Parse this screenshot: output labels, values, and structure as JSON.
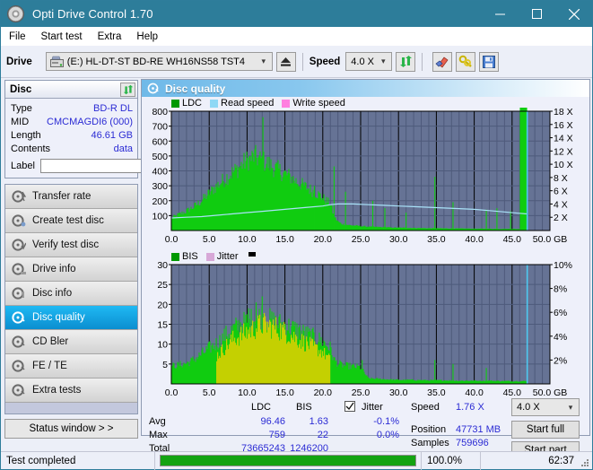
{
  "window": {
    "title": "Opti Drive Control 1.70",
    "icon": "disc-icon",
    "minimize": "minimize-icon",
    "maximize": "maximize-icon",
    "close": "close-icon"
  },
  "menu": {
    "items": [
      "File",
      "Start test",
      "Extra",
      "Help"
    ]
  },
  "toolbar": {
    "drive_label": "Drive",
    "drive_value": "(E:)  HL-DT-ST BD-RE  WH16NS58 TST4",
    "eject_icon": "eject-icon",
    "speed_label": "Speed",
    "speed_value": "4.0 X",
    "refresh_icon": "refresh-icon",
    "erase_icon": "eraser-icon",
    "key_icon": "keys-icon",
    "save_icon": "save-icon"
  },
  "disc_panel": {
    "title": "Disc",
    "refresh_icon": "refresh-icon",
    "rows": [
      {
        "key": "Type",
        "value": "BD-R DL"
      },
      {
        "key": "MID",
        "value": "CMCMAGDI6 (000)"
      },
      {
        "key": "Length",
        "value": "46.61 GB"
      },
      {
        "key": "Contents",
        "value": "data"
      }
    ],
    "label_key": "Label",
    "label_value": "",
    "label_placeholder": "",
    "label_button_icon": "disc-icon"
  },
  "nav": {
    "items": [
      {
        "label": "Transfer rate",
        "icon": "disc-transfer-icon",
        "selected": false
      },
      {
        "label": "Create test disc",
        "icon": "disc-create-icon",
        "selected": false
      },
      {
        "label": "Verify test disc",
        "icon": "disc-verify-icon",
        "selected": false
      },
      {
        "label": "Drive info",
        "icon": "disc-drive-icon",
        "selected": false
      },
      {
        "label": "Disc info",
        "icon": "disc-info-icon",
        "selected": false
      },
      {
        "label": "Disc quality",
        "icon": "disc-quality-icon",
        "selected": true
      },
      {
        "label": "CD Bler",
        "icon": "disc-bler-icon",
        "selected": false
      },
      {
        "label": "FE / TE",
        "icon": "disc-fete-icon",
        "selected": false
      },
      {
        "label": "Extra tests",
        "icon": "disc-extra-icon",
        "selected": false
      }
    ],
    "status_window_label": "Status window > >"
  },
  "card": {
    "title": "Disc quality",
    "icon": "disc-quality-icon"
  },
  "stats": {
    "col_ldc": "LDC",
    "col_bis": "BIS",
    "jitter_label": "Jitter",
    "jitter_checked": true,
    "rows": [
      {
        "key": "Avg",
        "ldc": "96.46",
        "bis": "1.63",
        "jitter": "-0.1%"
      },
      {
        "key": "Max",
        "ldc": "759",
        "bis": "22",
        "jitter": "0.0%"
      },
      {
        "key": "Total",
        "ldc": "73665243",
        "bis": "1246200",
        "jitter": ""
      }
    ],
    "speed_key": "Speed",
    "speed_value": "1.76 X",
    "position_key": "Position",
    "position_value": "47731 MB",
    "samples_key": "Samples",
    "samples_value": "759696",
    "speed_select": "4.0 X",
    "start_full": "Start full",
    "start_part": "Start part"
  },
  "statusbar": {
    "message": "Test completed",
    "percent_label": "100.0%",
    "percent_value": 100,
    "elapsed": "62:37"
  },
  "colors": {
    "accent": "#2d7d9a",
    "plot_bg": "#667395",
    "ldc_green": "#11cc11",
    "read_speed": "#8fd8f5",
    "write_speed": "#ff7fe0",
    "jitter": "#d7a8d7",
    "progress_green": "#13a312",
    "value_blue": "#2b2bd4",
    "selected_nav": "#12a6e8"
  },
  "chart_data": [
    {
      "type": "area",
      "name": "ldc-chart",
      "title": "",
      "xlabel": "GB",
      "ylabel": "",
      "xlim": [
        0,
        50
      ],
      "ylim": [
        0,
        800
      ],
      "y2lim": [
        0,
        18
      ],
      "y2label": "X",
      "xticks": [
        "0.0",
        "5.0",
        "10.0",
        "15.0",
        "20.0",
        "25.0",
        "30.0",
        "35.0",
        "40.0",
        "45.0",
        "50.0 GB"
      ],
      "yticks": [
        "100",
        "200",
        "300",
        "400",
        "500",
        "600",
        "700",
        "800"
      ],
      "y2ticks": [
        "2 X",
        "4 X",
        "6 X",
        "8 X",
        "10 X",
        "12 X",
        "14 X",
        "16 X",
        "18 X"
      ],
      "grid": true,
      "legend": [
        {
          "label": "LDC",
          "color": "#009900"
        },
        {
          "label": "Read speed",
          "color": "#8fd8f5"
        },
        {
          "label": "Write speed",
          "color": "#ff7fe0"
        }
      ],
      "series": [
        {
          "name": "LDC",
          "color": "#11cc11",
          "x": [
            0,
            0.5,
            1,
            1.5,
            2,
            2.5,
            3,
            3.5,
            4,
            4.5,
            5,
            5.5,
            6,
            6.5,
            7,
            7.5,
            8,
            8.5,
            9,
            9.5,
            10,
            10.5,
            11,
            11.5,
            12,
            12.5,
            13,
            13.5,
            14,
            14.5,
            15,
            15.5,
            16,
            16.5,
            17,
            17.5,
            18,
            18.5,
            19,
            19.5,
            20,
            20.5,
            21,
            21.5,
            22,
            22.5,
            23,
            23.5,
            24,
            24.5,
            25,
            26,
            27,
            28,
            29,
            30,
            31,
            32,
            33,
            34,
            35,
            36,
            37,
            38,
            39,
            40,
            41,
            42,
            43,
            44,
            45,
            46,
            47
          ],
          "values": [
            85,
            95,
            108,
            118,
            130,
            145,
            160,
            180,
            200,
            225,
            250,
            275,
            300,
            320,
            345,
            365,
            385,
            405,
            425,
            450,
            470,
            480,
            500,
            480,
            470,
            455,
            440,
            425,
            410,
            395,
            380,
            365,
            350,
            330,
            315,
            300,
            285,
            270,
            255,
            240,
            220,
            200,
            180,
            95,
            60,
            45,
            40,
            36,
            34,
            32,
            30,
            26,
            24,
            22,
            20,
            19,
            18,
            17,
            16,
            15,
            15,
            14,
            14,
            13,
            13,
            12,
            12,
            12,
            11,
            11,
            11,
            10
          ]
        },
        {
          "name": "Read speed",
          "color": "#8fd8f5",
          "x": [
            0,
            2,
            4,
            6,
            8,
            10,
            12,
            14,
            16,
            18,
            20,
            21,
            22,
            24,
            26,
            28,
            30,
            32,
            34,
            36,
            38,
            40,
            42,
            44,
            46,
            47
          ],
          "values_x": [
            1.9,
            2.0,
            2.1,
            2.3,
            2.5,
            2.7,
            2.9,
            3.1,
            3.3,
            3.5,
            3.7,
            3.9,
            4.0,
            4.0,
            3.9,
            3.8,
            3.7,
            3.6,
            3.5,
            3.4,
            3.3,
            3.2,
            3.0,
            2.8,
            2.6,
            2.5
          ]
        }
      ],
      "cursor_x": 47.0
    },
    {
      "type": "area",
      "name": "bis-jitter-chart",
      "title": "",
      "xlabel": "GB",
      "ylabel": "",
      "xlim": [
        0,
        50
      ],
      "ylim": [
        0,
        30
      ],
      "y2lim": [
        0,
        10
      ],
      "y2label": "%",
      "xticks": [
        "0.0",
        "5.0",
        "10.0",
        "15.0",
        "20.0",
        "25.0",
        "30.0",
        "35.0",
        "40.0",
        "45.0",
        "50.0 GB"
      ],
      "yticks": [
        "5",
        "10",
        "15",
        "20",
        "25",
        "30"
      ],
      "y2ticks": [
        "2%",
        "4%",
        "6%",
        "8%",
        "10%"
      ],
      "grid": true,
      "legend": [
        {
          "label": "BIS",
          "color": "#009900"
        },
        {
          "label": "Jitter",
          "color": "#d7a8d7"
        }
      ],
      "series": [
        {
          "name": "BIS",
          "color": "#11cc11",
          "x": [
            0,
            0.5,
            1,
            1.5,
            2,
            2.5,
            3,
            3.5,
            4,
            4.5,
            5,
            5.5,
            6,
            6.5,
            7,
            7.5,
            8,
            8.5,
            9,
            9.5,
            10,
            10.5,
            11,
            11.5,
            12,
            12.5,
            13,
            13.5,
            14,
            14.5,
            15,
            15.5,
            16,
            16.5,
            17,
            17.5,
            18,
            18.5,
            19,
            19.5,
            20,
            20.5,
            21,
            21.5,
            22,
            22.5,
            23,
            24,
            25,
            26,
            28,
            30,
            32,
            34,
            36,
            38,
            40,
            42,
            44,
            46,
            47
          ],
          "values": [
            4.5,
            4.6,
            4.8,
            5.0,
            5.2,
            5.6,
            6.2,
            6.8,
            7.5,
            8.2,
            9.0,
            9.5,
            10.2,
            11.0,
            12.0,
            12.8,
            13.5,
            14.2,
            14.8,
            15.2,
            15.6,
            16.0,
            16.5,
            16.8,
            17.2,
            16.5,
            16.0,
            15.6,
            15.2,
            15.0,
            14.8,
            14.4,
            14.0,
            13.6,
            13.2,
            12.8,
            12.4,
            12.0,
            11.6,
            11.2,
            10.6,
            9.8,
            9.0,
            6.0,
            5.2,
            4.8,
            4.6,
            4.4,
            4.2,
            1.4,
            1.2,
            1.0,
            1.0,
            0.9,
            0.9,
            0.8,
            0.8,
            0.8,
            0.7,
            0.7,
            0.7
          ]
        },
        {
          "name": "Jitter",
          "color": "#d8d100",
          "x": [
            6,
            7,
            8,
            9,
            10,
            11,
            12,
            13,
            14,
            15,
            16,
            17,
            18,
            19,
            20,
            21
          ],
          "values": [
            7,
            9,
            11,
            12,
            13,
            14,
            15,
            14.5,
            14,
            13,
            12,
            11,
            10,
            9,
            8,
            6
          ]
        }
      ],
      "cursor_x": 47.0
    }
  ]
}
